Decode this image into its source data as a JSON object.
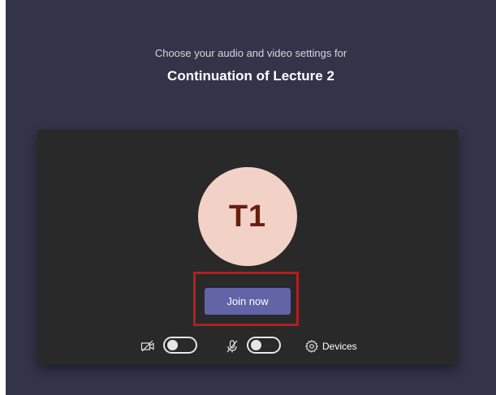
{
  "header": {
    "subtitle": "Choose your audio and video settings for",
    "meeting_title": "Continuation of Lecture 2"
  },
  "preview": {
    "avatar_initials": "T1",
    "avatar_color": "#f2d1c6",
    "join_label": "Join now",
    "join_color": "#6264a7",
    "highlight_color": "#b11f1f"
  },
  "controls": {
    "camera": {
      "icon": "camera-off-icon",
      "state": "off"
    },
    "microphone": {
      "icon": "mic-off-icon",
      "state": "off"
    },
    "devices": {
      "icon": "gear-icon",
      "label": "Devices"
    }
  }
}
